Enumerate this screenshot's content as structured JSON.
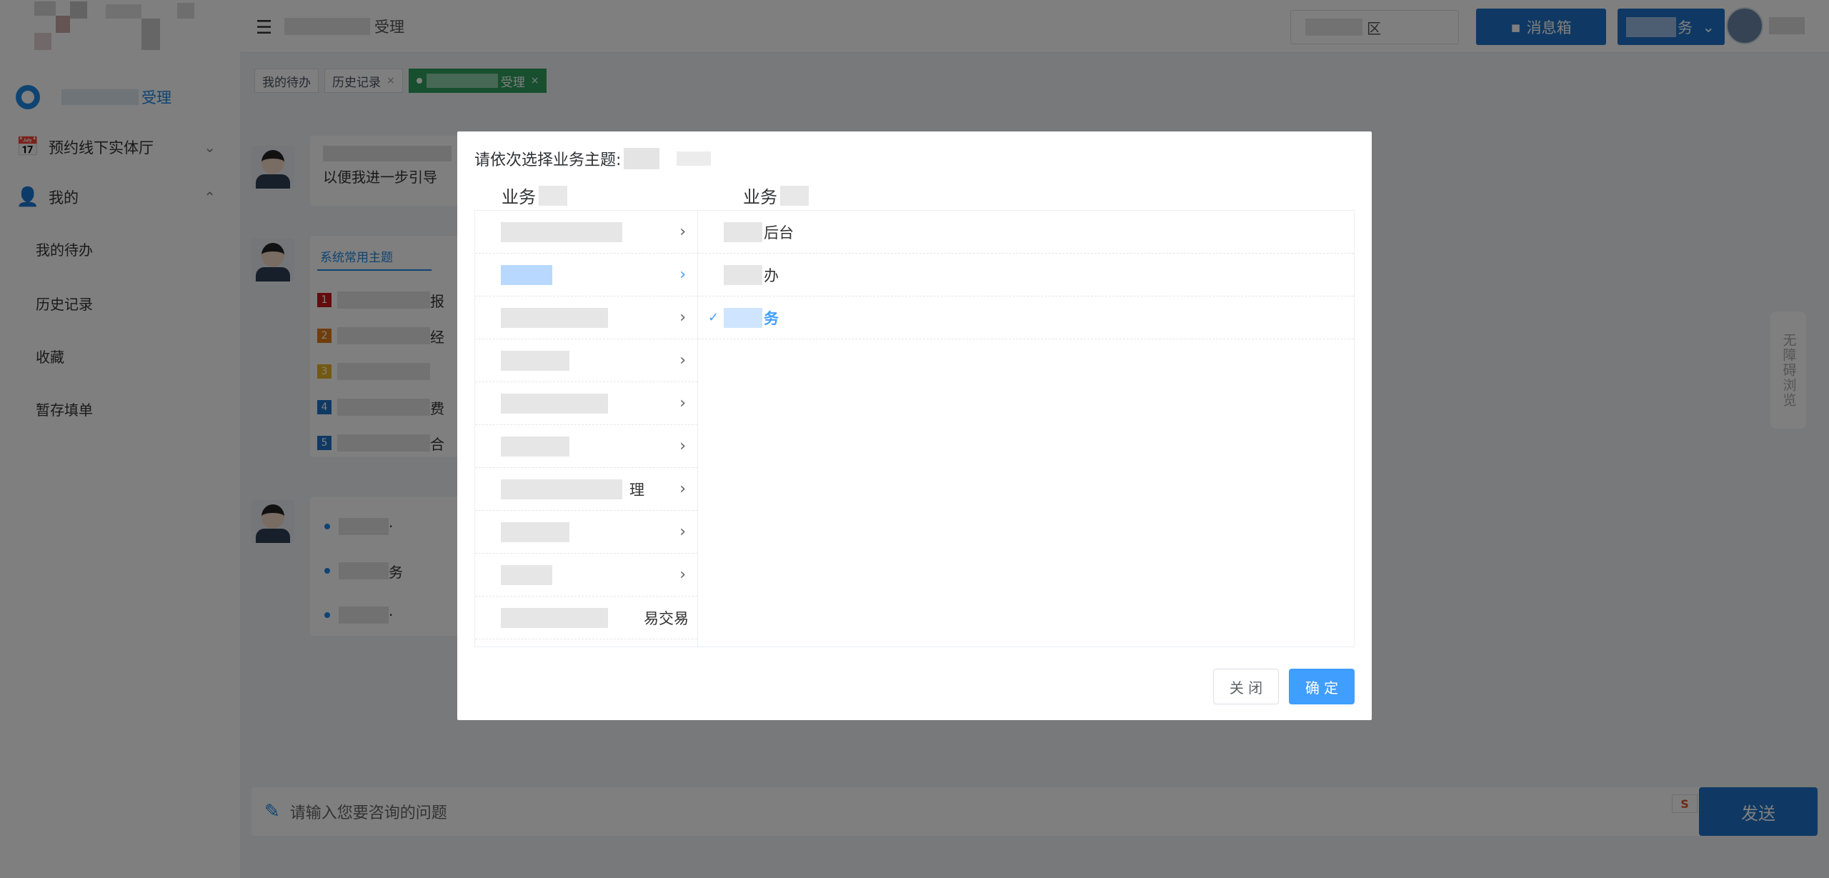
{
  "sidebar": {
    "home_suffix": "受理",
    "menu": [
      {
        "label": "预约线下实体厅",
        "arrow": "⌄"
      },
      {
        "label": "我的",
        "arrow": "⌃"
      }
    ],
    "submenu": [
      "我的待办",
      "历史记录",
      "收藏",
      "暂存填单"
    ]
  },
  "header": {
    "title_suffix": "受理",
    "search_suffix": "区",
    "inbox_label": "消息箱",
    "biz_suffix": "务"
  },
  "tabs": {
    "todo": "我的待办",
    "history": "历史记录",
    "active_suffix": "受理",
    "close": "×"
  },
  "chat": {
    "msg1_line2": "以便我进一步引导",
    "topics_tab": "系统常用主题",
    "topics": [
      {
        "num": "1",
        "color": "#c8161d",
        "suffix": "报"
      },
      {
        "num": "2",
        "color": "#e07b16",
        "suffix": "经"
      },
      {
        "num": "3",
        "color": "#e6b422",
        "suffix": ""
      },
      {
        "num": "4",
        "color": "#1f72c9",
        "suffix": "费"
      },
      {
        "num": "5",
        "color": "#1f72c9",
        "suffix": "合"
      }
    ],
    "links": [
      {
        "suffix": "·"
      },
      {
        "suffix": "务"
      },
      {
        "suffix": "·"
      }
    ]
  },
  "input": {
    "placeholder": "请输入您要咨询的问题",
    "send_label": "发送"
  },
  "a11y_label": "无障碍浏览",
  "modal": {
    "title": "请依次选择业务主题:",
    "col1_head": "业务",
    "col2_head": "业务",
    "left_items": [
      {
        "suffix": ""
      },
      {
        "suffix": ""
      },
      {
        "suffix": ""
      },
      {
        "suffix": ""
      },
      {
        "suffix": ""
      },
      {
        "suffix": ""
      },
      {
        "suffix": "理"
      },
      {
        "suffix": ""
      },
      {
        "suffix": ""
      },
      {
        "suffix": "易交易"
      }
    ],
    "right_items": [
      {
        "suffix": "后台"
      },
      {
        "suffix": "办"
      },
      {
        "suffix": "务"
      }
    ],
    "close_label": "关 闭",
    "ok_label": "确 定"
  }
}
